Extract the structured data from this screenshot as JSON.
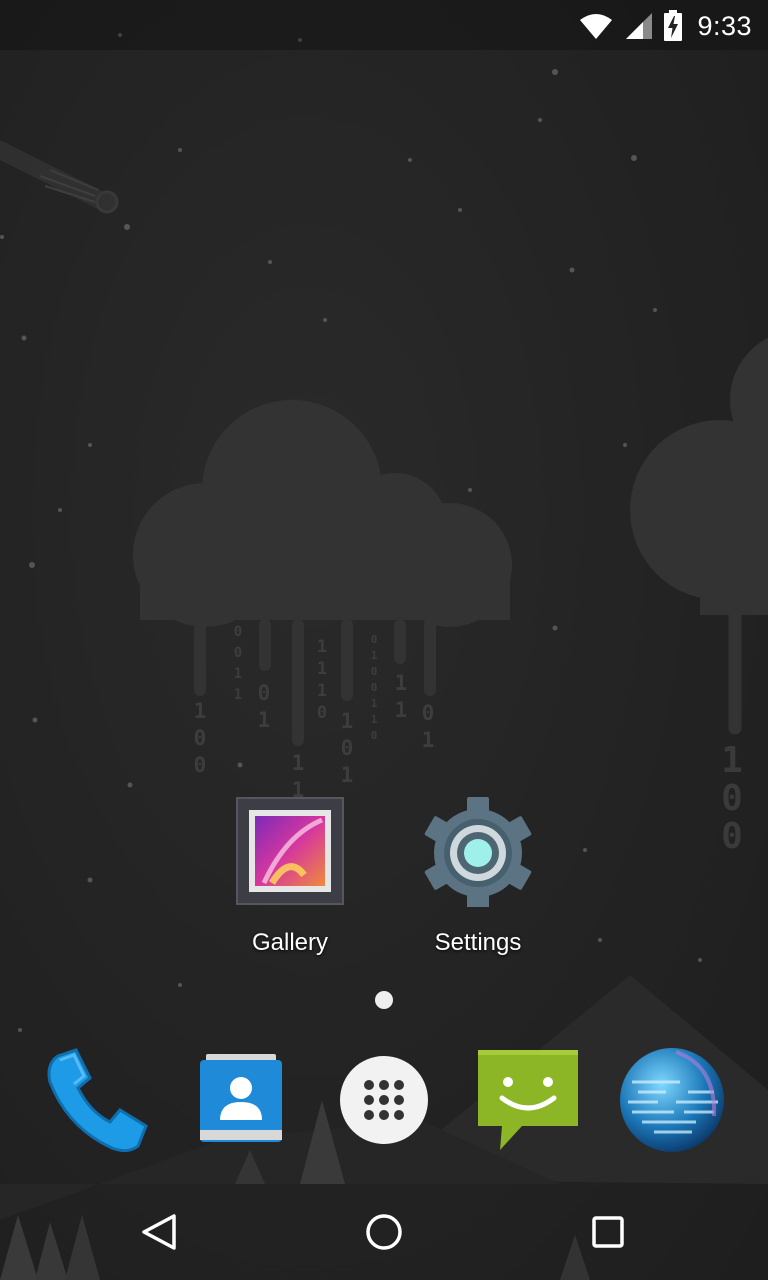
{
  "status_bar": {
    "time": "9:33",
    "icons": [
      "wifi-icon",
      "cell-signal-icon",
      "battery-charging-icon"
    ]
  },
  "wallpaper": {
    "binary_streams": [
      "100",
      "0011",
      "01",
      "11",
      "1110",
      "101",
      "0100110",
      "11",
      "01",
      "100"
    ]
  },
  "home": {
    "apps": [
      {
        "label": "Gallery",
        "icon": "gallery-icon"
      },
      {
        "label": "Settings",
        "icon": "settings-gear-icon"
      }
    ],
    "page_count": 1,
    "current_page": 1
  },
  "dock": {
    "items": [
      "phone-icon",
      "contacts-icon",
      "app-drawer-icon",
      "messaging-icon",
      "browser-globe-icon"
    ]
  },
  "nav_bar": {
    "buttons": [
      "back-icon",
      "home-icon",
      "recents-icon"
    ]
  },
  "colors": {
    "background": "#232323",
    "phone_blue": "#1e9be6",
    "contacts_blue": "#1f8ad8",
    "messaging_green": "#8db626",
    "settings_teal": "#9ff0ea"
  }
}
